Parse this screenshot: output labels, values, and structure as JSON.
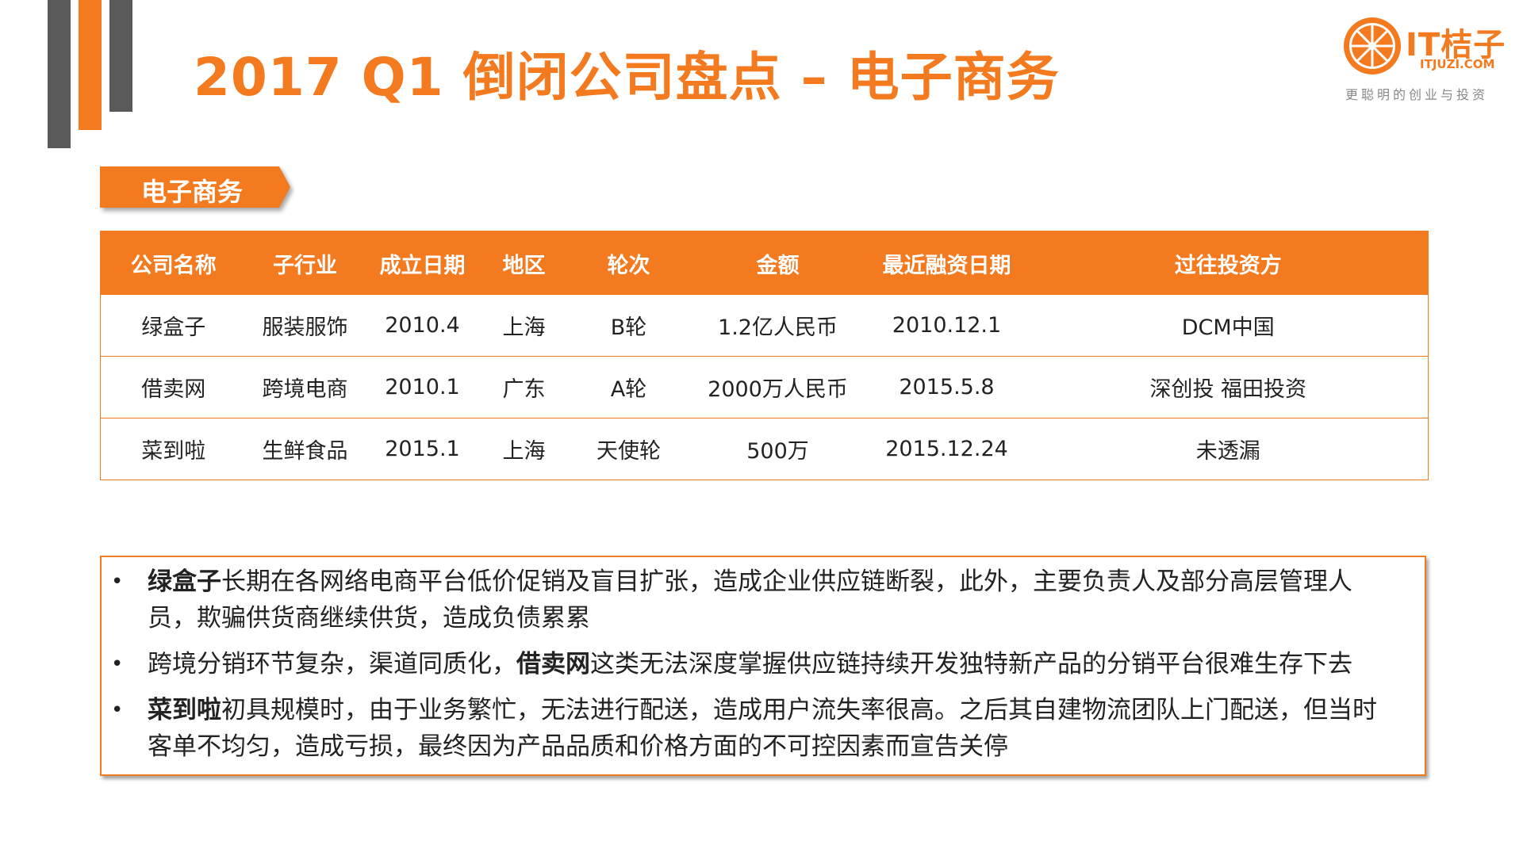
{
  "header": {
    "title": "2017 Q1 倒闭公司盘点 – 电子商务"
  },
  "logo": {
    "name": "IT桔子",
    "url": "ITJUZI.COM",
    "slogan": "更聪明的创业与投资",
    "icon": "orange-slice-icon",
    "color": "#f47a20"
  },
  "section": {
    "label": "电子商务"
  },
  "table": {
    "columns": [
      "公司名称",
      "子行业",
      "成立日期",
      "地区",
      "轮次",
      "金额",
      "最近融资日期",
      "过往投资方"
    ],
    "rows": [
      [
        "绿盒子",
        "服装服饰",
        "2010.4",
        "上海",
        "B轮",
        "1.2亿人民币",
        "2010.12.1",
        "DCM中国"
      ],
      [
        "借卖网",
        "跨境电商",
        "2010.1",
        "广东",
        "A轮",
        "2000万人民币",
        "2015.5.8",
        "深创投 福田投资"
      ],
      [
        "菜到啦",
        "生鲜食品",
        "2015.1",
        "上海",
        "天使轮",
        "500万",
        "2015.12.24",
        "未透漏"
      ]
    ]
  },
  "notes": [
    {
      "bullet": "•",
      "pre": "",
      "bold": "绿盒子",
      "post": "长期在各网络电商平台低价促销及盲目扩张，造成企业供应链断裂，此外，主要负责人及部分高层管理人员，欺骗供货商继续供货，造成负债累累"
    },
    {
      "bullet": "•",
      "pre": "跨境分销环节复杂，渠道同质化，",
      "bold": "借卖网",
      "post": "这类无法深度掌握供应链持续开发独特新产品的分销平台很难生存下去"
    },
    {
      "bullet": "•",
      "pre": "",
      "bold": "菜到啦",
      "post": "初具规模时，由于业务繁忙，无法进行配送，造成用户流失率很高。之后其自建物流团队上门配送，但当时客单不均匀，造成亏损，最终因为产品品质和价格方面的不可控因素而宣告关停"
    }
  ],
  "colors": {
    "accent": "#f47a20",
    "dark_bar": "#595959"
  }
}
